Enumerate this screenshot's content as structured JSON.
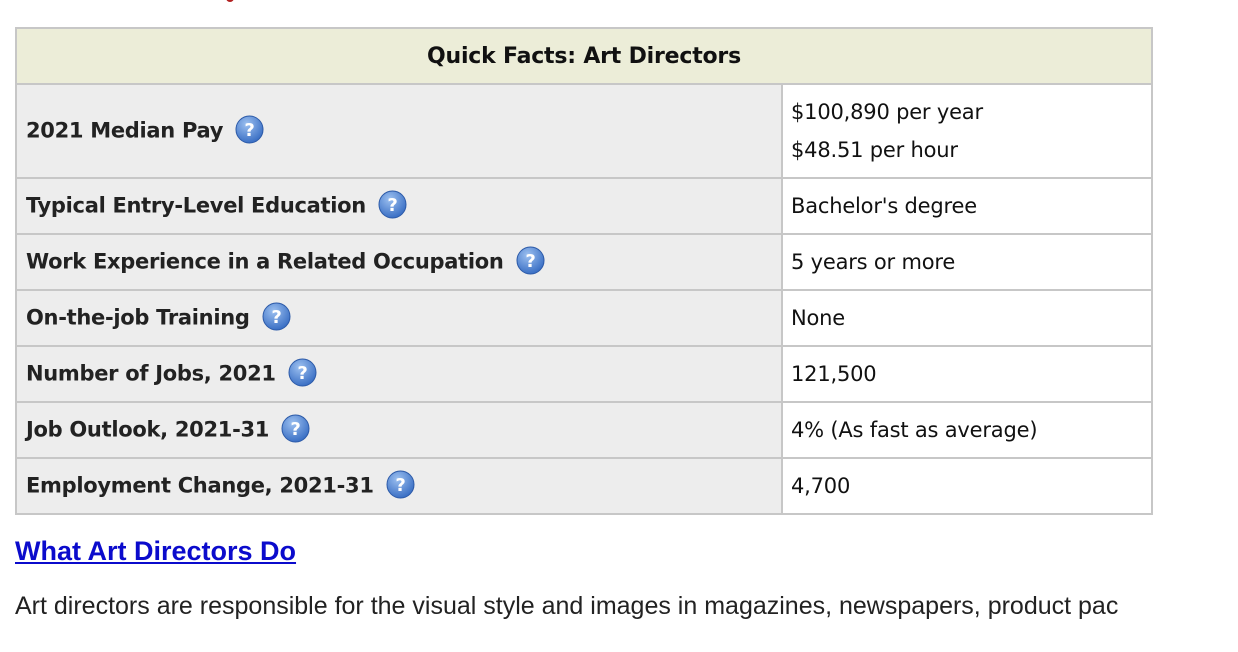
{
  "quick_facts": {
    "title": "Quick Facts: Art Directors",
    "help_icon": "question-mark-help-icon",
    "rows": [
      {
        "label": "2021 Median Pay",
        "values": [
          "$100,890 per year",
          "$48.51 per hour"
        ]
      },
      {
        "label": "Typical Entry-Level Education",
        "values": [
          "Bachelor's degree"
        ]
      },
      {
        "label": "Work Experience in a Related Occupation",
        "values": [
          "5 years or more"
        ]
      },
      {
        "label": "On-the-job Training",
        "values": [
          "None"
        ]
      },
      {
        "label": "Number of Jobs, 2021",
        "values": [
          "121,500"
        ]
      },
      {
        "label": "Job Outlook, 2021-31",
        "values": [
          "4% (As fast as average)"
        ]
      },
      {
        "label": "Employment Change, 2021-31",
        "values": [
          "4,700"
        ]
      }
    ]
  },
  "section": {
    "heading": "What Art Directors Do",
    "intro": "Art directors are responsible for the visual style and images in magazines, newspapers, product pac"
  },
  "colors": {
    "title_bg": "#ecedd8",
    "label_bg": "#ededed",
    "border": "#c7c7c7",
    "link": "#0b0bcc",
    "help_icon": "#3a6fc4"
  }
}
